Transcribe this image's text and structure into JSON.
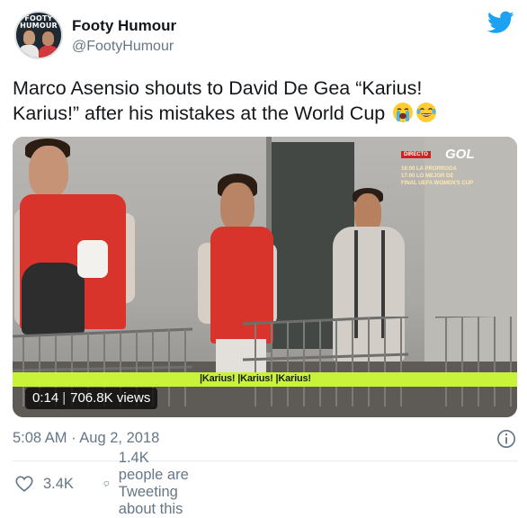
{
  "account": {
    "display_name": "Footy Humour",
    "handle": "@FootyHumour",
    "avatar_logo_line1": "FOOTY",
    "avatar_logo_line2": "HUMOUR"
  },
  "tweet": {
    "text_line1": "Marco Asensio shouts to David De Gea “Karius!",
    "text_line2": "Karius!” after his mistakes at the World Cup",
    "emojis": [
      "loudly-crying-face",
      "crying-laughing-face"
    ]
  },
  "video": {
    "time": "0:14",
    "views": "706.8K views",
    "banner_text": "|Karius! |Karius! |Karius!",
    "tv_badge": "DIRECTO",
    "tv_channel": "GOL",
    "tv_line1": "16:00 LA PRORROGA",
    "tv_line2": "17:00 LO MEJOR DE",
    "tv_line3": "FINAL UEFA WOMEN'S CUP"
  },
  "meta": {
    "timestamp": "5:08 AM · Aug 2, 2018"
  },
  "actions": {
    "likes": "3.4K",
    "talking": "1.4K people are Tweeting about this"
  },
  "colors": {
    "twitter_blue": "#1DA1F2",
    "secondary_text": "#657786",
    "banner_green": "#c9f23b"
  }
}
